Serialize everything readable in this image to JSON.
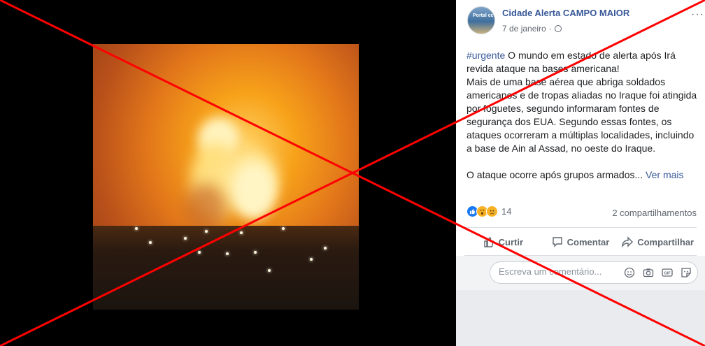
{
  "post": {
    "page_name": "Cidade Alerta CAMPO MAIOR",
    "avatar_text": "Portal cc",
    "date": "7 de janeiro",
    "separator": "·",
    "more": "···",
    "hashtag": "#urgente",
    "headline": " O mundo em estado de alerta após Irá revida ataque na bases americana!",
    "body": "Mais de uma base aérea que abriga soldados americanos e de tropas aliadas no Iraque foi atingida por foguetes, segundo informaram fontes de segurança dos EUA. Segundo essas fontes, os ataques ocorreram a múltiplas localidades, incluindo a base de Ain al Assad, no oeste do Iraque.",
    "teaser": "O ataque ocorre após grupos armados...",
    "see_more": "Ver mais"
  },
  "reactions": {
    "count": "14",
    "shares": "2 compartilhamentos",
    "icons": [
      "like-icon",
      "wow-icon",
      "sad-icon"
    ]
  },
  "actions": {
    "like_label": "Curtir",
    "comment_label": "Comentar",
    "share_label": "Compartilhar"
  },
  "comment": {
    "placeholder": "Escreva um comentário...",
    "icons": [
      "emoji-icon",
      "camera-icon",
      "gif-icon",
      "sticker-icon"
    ]
  },
  "colors": {
    "link": "#385898",
    "overlay_x": "#ff0000",
    "like": "#1877f2"
  }
}
